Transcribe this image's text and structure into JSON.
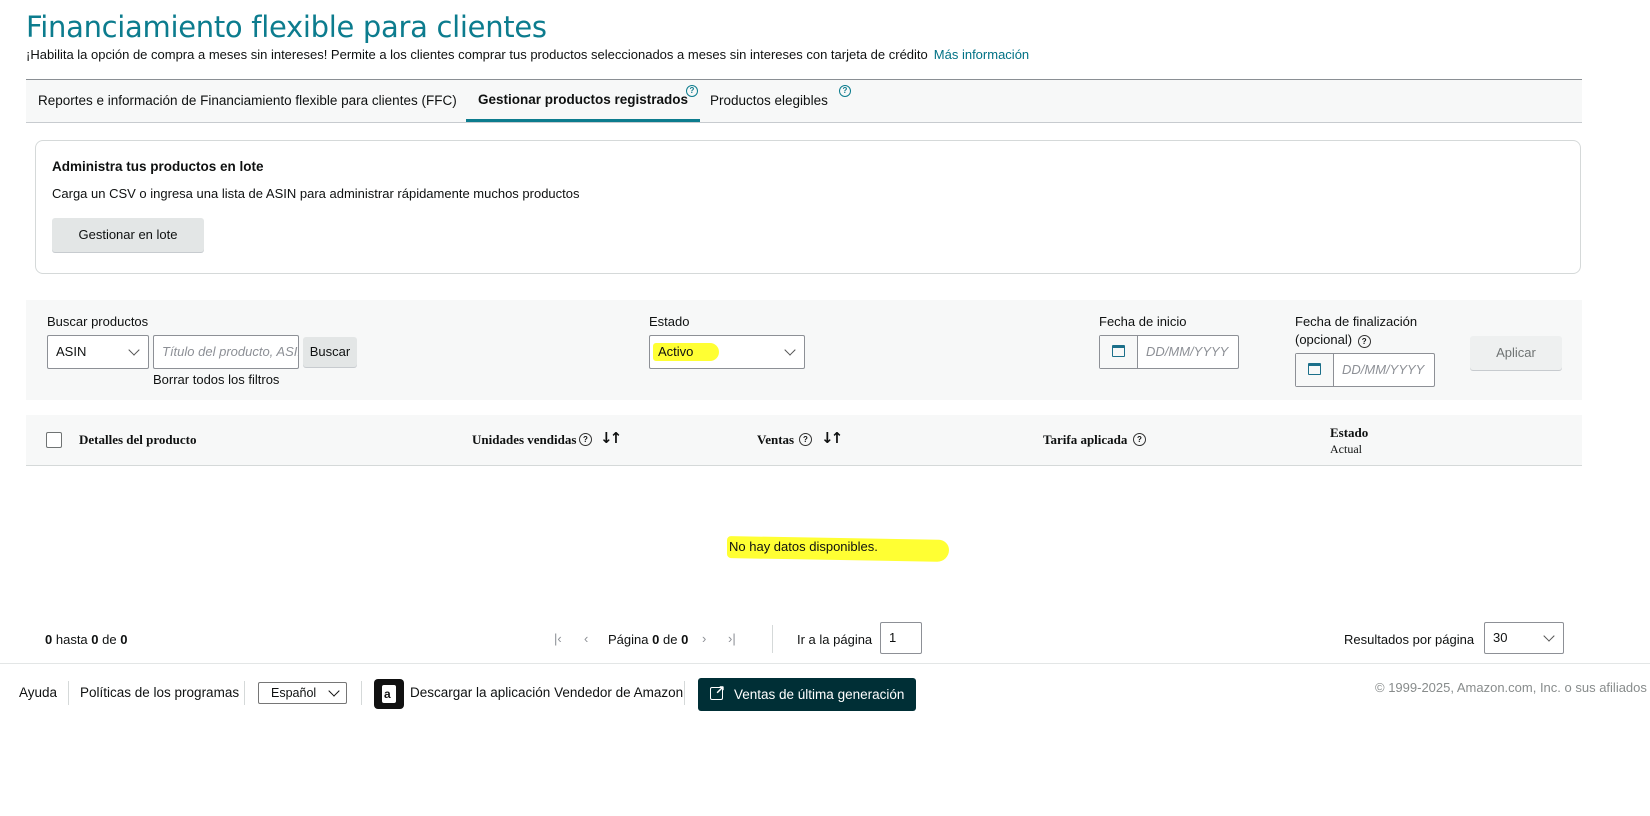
{
  "header": {
    "title": "Financiamiento flexible para clientes",
    "subtitle": "¡Habilita la opción de compra a meses sin intereses! Permite a los clientes comprar tus productos seleccionados a meses sin intereses con tarjeta de crédito",
    "more_info": "Más información"
  },
  "tabs": [
    {
      "label": "Reportes e información de Financiamiento flexible para clientes (FFC)",
      "active": false
    },
    {
      "label": "Gestionar productos registrados",
      "active": true
    },
    {
      "label": "Productos elegibles",
      "active": false
    }
  ],
  "batch": {
    "title": "Administra tus productos en lote",
    "description": "Carga un CSV o ingresa una lista de ASIN para administrar rápidamente muchos productos",
    "button": "Gestionar en lote"
  },
  "filters": {
    "search_label": "Buscar productos",
    "search_type": "ASIN",
    "search_placeholder": "Título del producto, ASIN",
    "search_button": "Buscar",
    "clear_filters": "Borrar todos los filtros",
    "status_label": "Estado",
    "status_value": "Activo",
    "start_date_label": "Fecha de inicio",
    "start_date_placeholder": "DD/MM/YYYY",
    "end_date_label_1": "Fecha de finalización",
    "end_date_label_2": "(opcional)",
    "end_date_placeholder": "DD/MM/YYYY",
    "apply_button": "Aplicar"
  },
  "table": {
    "columns": {
      "product": "Detalles del producto",
      "units": "Unidades vendidas",
      "sales": "Ventas",
      "fee": "Tarifa aplicada",
      "status": "Estado",
      "status_sub": "Actual"
    },
    "empty_message": "No hay datos disponibles."
  },
  "pagination": {
    "range_from": "0",
    "range_to_word": "hasta",
    "range_to": "0",
    "of_word": "de",
    "total": "0",
    "page_word": "Página",
    "current_page": "0",
    "total_pages": "0",
    "goto_label": "Ir a la página",
    "goto_value": "1",
    "per_page_label": "Resultados por página",
    "per_page_value": "30"
  },
  "footer": {
    "help": "Ayuda",
    "policies": "Políticas de los programas",
    "language": "Español",
    "download_app": "Descargar la aplicación Vendedor de Amazon",
    "next_gen": "Ventas de última generación",
    "copyright": "© 1999-2025, Amazon.com, Inc. o sus afiliados"
  },
  "colors": {
    "brand_teal": "#0c7c8e",
    "link": "#007185",
    "highlight": "#ffff33",
    "next_gen_bg": "#002f36"
  }
}
